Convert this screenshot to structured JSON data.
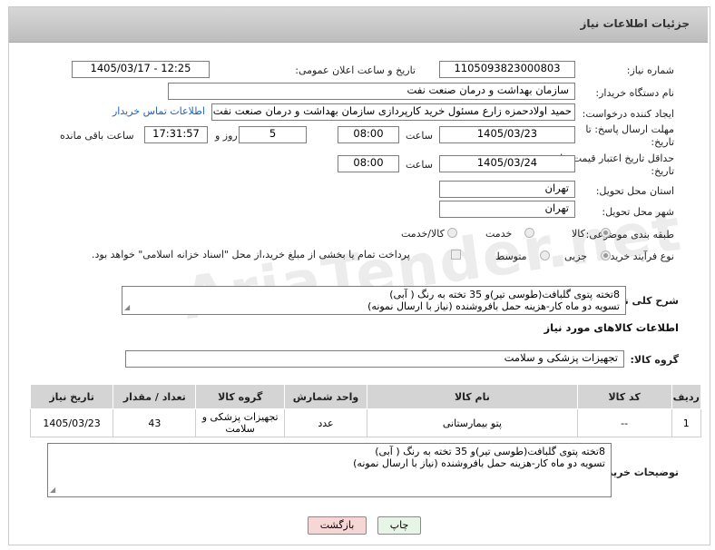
{
  "header": {
    "title": "جزئیات اطلاعات نیاز"
  },
  "fields": {
    "need_number_label": "شماره نیاز:",
    "need_number": "1105093823000803",
    "announce_label": "تاریخ و ساعت اعلان عمومی:",
    "announce_value": "1405/03/17 - 12:25",
    "buyer_org_label": "نام دستگاه خریدار:",
    "buyer_org": "سازمان بهداشت و درمان صنعت نفت",
    "requester_label": "ایجاد کننده درخواست:",
    "requester": "حمید اولادحمزه زارع مسئول خرید کارپردازی سازمان بهداشت و درمان صنعت نفت",
    "contact_link": "اطلاعات تماس خریدار",
    "deadline_label": "مهلت ارسال پاسخ: تا تاریخ:",
    "deadline_date": "1405/03/23",
    "time_label": "ساعت",
    "deadline_time": "08:00",
    "days_value": "5",
    "days_label": "روز و",
    "remaining_time": "17:31:57",
    "remaining_label": "ساعت باقی مانده",
    "price_validity_label": "حداقل تاریخ اعتبار قیمت: تا تاریخ:",
    "price_validity_date": "1405/03/24",
    "price_validity_time": "08:00",
    "province_label": "استان محل تحویل:",
    "province": "تهران",
    "city_label": "شهر محل تحویل:",
    "city": "تهران",
    "category_label": "طبقه بندی موضوعی:",
    "category_options": [
      "کالا",
      "خدمت",
      "کالا/خدمت"
    ],
    "process_label": "نوع فرآیند خرید :",
    "process_options": [
      "جزیی",
      "متوسط"
    ],
    "process_note": "پرداخت تمام یا بخشی از مبلغ خرید،از محل \"اسناد خزانه اسلامی\" خواهد بود.",
    "desc_label": "شرح کلی نیاز:",
    "desc_lines": [
      "8تخته پتوی گلبافت(طوسی تیر)و 35 تخته به رنگ ( آبی)",
      "تسویه دو ماه کار-هزینه حمل بافروشنده (نیاز با ارسال نمونه)"
    ]
  },
  "goods": {
    "section_title": "اطلاعات کالاهای مورد نیاز",
    "group_label": "گروه کالا:",
    "group_value": "تجهیزات پزشکی و سلامت",
    "columns": [
      "ردیف",
      "کد کالا",
      "نام کالا",
      "واحد شمارش",
      "گروه کالا",
      "تعداد / مقدار",
      "تاریخ نیاز"
    ],
    "rows": [
      {
        "row": "1",
        "code": "--",
        "name": "پتو بیمارستانی",
        "unit": "عدد",
        "group": "تجهیزات پزشکی و سلامت",
        "qty": "43",
        "date": "1405/03/23"
      }
    ]
  },
  "buyer_notes": {
    "label": "توضیحات خریدار:",
    "lines": [
      "8تخته پتوی گلبافت(طوسی تیر)و 35 تخته به رنگ ( آبی)",
      "تسویه دو ماه کار-هزینه حمل بافروشنده (نیاز با ارسال نمونه)"
    ]
  },
  "buttons": {
    "print": "چاپ",
    "back": "بازگشت"
  },
  "watermark": "AriaTender.net",
  "colors": {
    "header_bg": "#c8c8c8",
    "link": "#2060c0",
    "back_button_bg": "#f7d6d6",
    "print_button_bg": "#e6f5e6"
  }
}
